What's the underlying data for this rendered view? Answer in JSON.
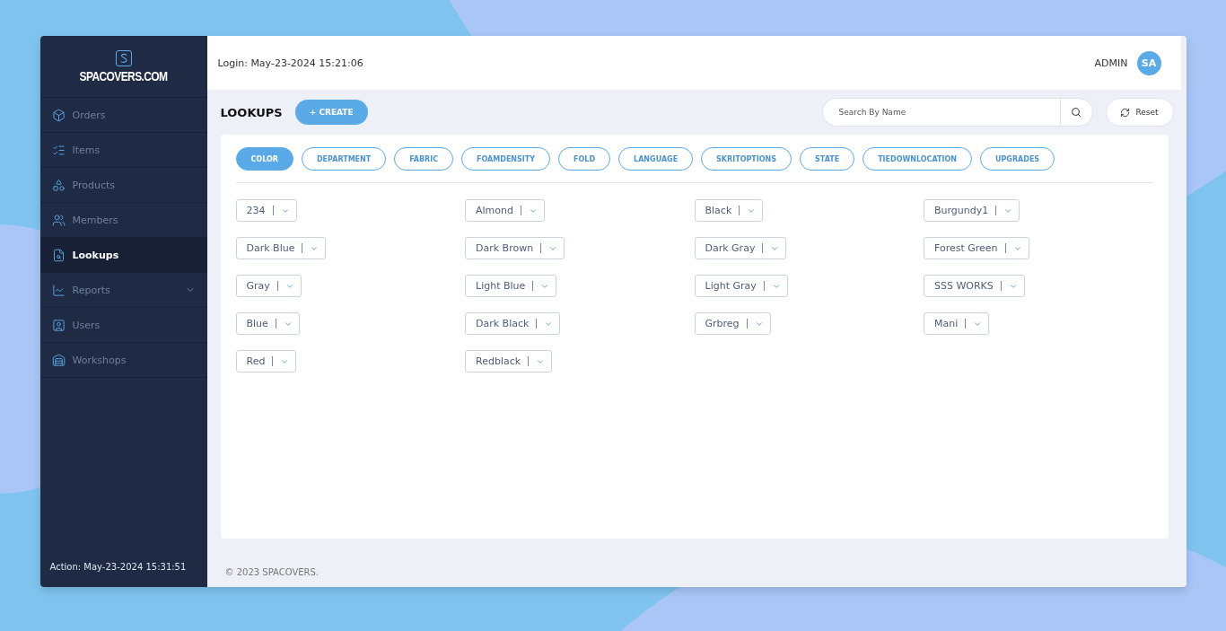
{
  "sidebar": {
    "logo": "SPACOVERS.COM",
    "items": [
      {
        "label": "Orders",
        "selected": false,
        "expandable": false
      },
      {
        "label": "Items",
        "selected": false,
        "expandable": false
      },
      {
        "label": "Products",
        "selected": false,
        "expandable": false
      },
      {
        "label": "Members",
        "selected": false,
        "expandable": false
      },
      {
        "label": "Lookups",
        "selected": true,
        "expandable": false
      },
      {
        "label": "Reports",
        "selected": false,
        "expandable": true
      },
      {
        "label": "Users",
        "selected": false,
        "expandable": false
      },
      {
        "label": "Workshops",
        "selected": false,
        "expandable": false
      }
    ],
    "footer": "Action: May-23-2024 15:31:51"
  },
  "header": {
    "login": "Login: May-23-2024 15:21:06",
    "user": "ADMIN",
    "avatar": "SA"
  },
  "page": {
    "title": "LOOKUPS",
    "create_button": "+ CREATE",
    "search": {
      "placeholder": "Search By Name"
    },
    "reset_button": "Reset"
  },
  "tabs": [
    {
      "label": "COLOR",
      "selected": true
    },
    {
      "label": "DEPARTMENT",
      "selected": false
    },
    {
      "label": "FABRIC",
      "selected": false
    },
    {
      "label": "FOAMDENSITY",
      "selected": false
    },
    {
      "label": "FOLD",
      "selected": false
    },
    {
      "label": "LANGUAGE",
      "selected": false
    },
    {
      "label": "SKRITOPTIONS",
      "selected": false
    },
    {
      "label": "STATE",
      "selected": false
    },
    {
      "label": "TIEDOWNLOCATION",
      "selected": false
    },
    {
      "label": "UPGRADES",
      "selected": false
    }
  ],
  "lookups": [
    "234",
    "Almond",
    "Black",
    "Burgundy1",
    "Dark Blue",
    "Dark Brown",
    "Dark Gray",
    "Forest Green",
    "Gray",
    "Light Blue",
    "Light Gray",
    "SSS WORKS",
    "Blue",
    "Dark Black",
    "Grbreg",
    "Mani",
    "Red",
    "Redblack"
  ],
  "footer": "© 2023 SPACOVERS."
}
